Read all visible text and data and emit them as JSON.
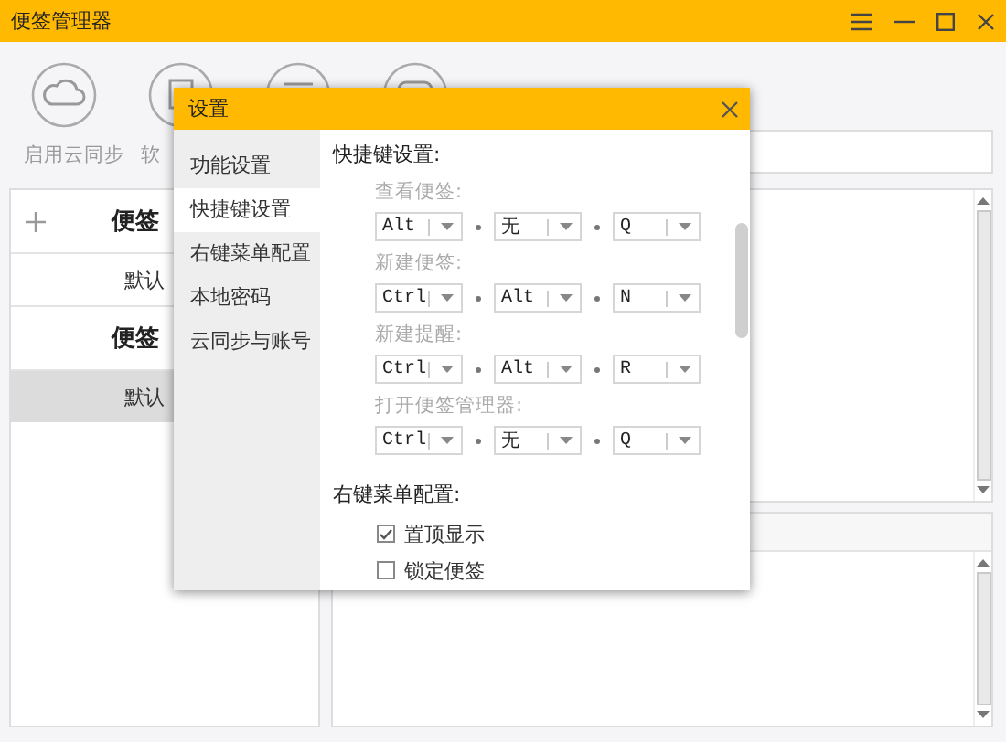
{
  "window": {
    "title": "便签管理器"
  },
  "toolbar": [
    {
      "kind": "cloud",
      "label": "启用云同步"
    },
    {
      "kind": "box",
      "label": "软"
    },
    {
      "kind": "list"
    },
    {
      "kind": "chat"
    }
  ],
  "sidebar": {
    "items": [
      {
        "kind": "header",
        "label": "便签",
        "add": true,
        "selected": false
      },
      {
        "kind": "item",
        "label": "默认",
        "add": false,
        "selected": false
      },
      {
        "kind": "header",
        "label": "便签",
        "add": false,
        "selected": false
      },
      {
        "kind": "item",
        "label": "默认",
        "add": false,
        "selected": true
      }
    ]
  },
  "dialog": {
    "title": "设置",
    "nav": [
      {
        "label": "功能设置",
        "selected": false
      },
      {
        "label": "快捷键设置",
        "selected": true
      },
      {
        "label": "右键菜单配置",
        "selected": false
      },
      {
        "label": "本地密码",
        "selected": false
      },
      {
        "label": "云同步与账号",
        "selected": false
      }
    ],
    "shortcuts_title": "快捷键设置:",
    "shortcuts": [
      {
        "label": "查看便签:",
        "keys": [
          "Alt",
          "无",
          "Q"
        ]
      },
      {
        "label": "新建便签:",
        "keys": [
          "Ctrl",
          "Alt",
          "N"
        ]
      },
      {
        "label": "新建提醒:",
        "keys": [
          "Ctrl",
          "Alt",
          "R"
        ]
      },
      {
        "label": "打开便签管理器:",
        "keys": [
          "Ctrl",
          "无",
          "Q"
        ]
      }
    ],
    "context_menu_title": "右键菜单配置:",
    "context_menu": [
      {
        "label": "置顶显示",
        "checked": true
      },
      {
        "label": "锁定便签",
        "checked": false
      }
    ]
  }
}
